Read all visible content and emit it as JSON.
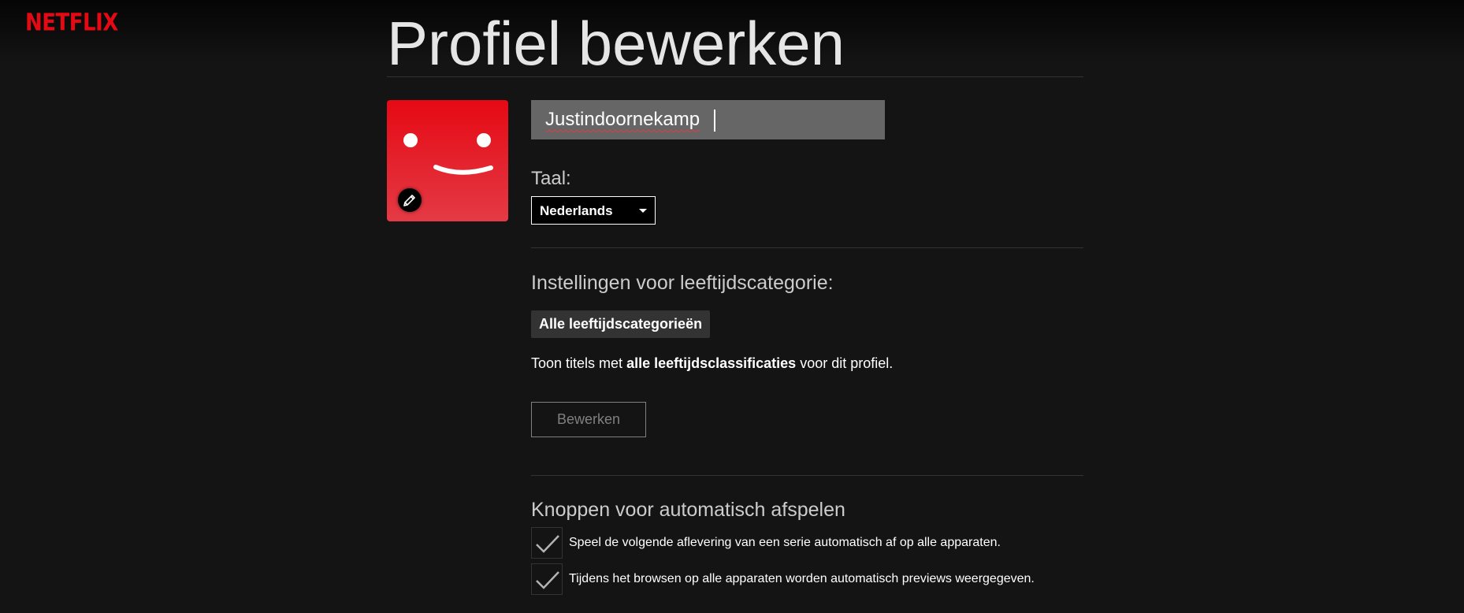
{
  "header": {
    "logo_text": "NETFLIX"
  },
  "page": {
    "title": "Profiel bewerken"
  },
  "profile": {
    "name_value": "Justindoornekamp",
    "avatar_icon": "smiley-face-icon",
    "edit_avatar_icon": "pencil-icon"
  },
  "language": {
    "label": "Taal:",
    "selected": "Nederlands"
  },
  "maturity": {
    "heading": "Instellingen voor leeftijdscategorie:",
    "badge": "Alle leeftijdscategorieën",
    "desc_prefix": "Toon titels met ",
    "desc_bold": "alle leeftijdsclassificaties",
    "desc_suffix": " voor dit profiel.",
    "edit_label": "Bewerken"
  },
  "autoplay": {
    "heading": "Knoppen voor automatisch afspelen",
    "options": [
      {
        "label": "Speel de volgende aflevering van een serie automatisch af op alle apparaten.",
        "checked": true
      },
      {
        "label": "Tijdens het browsen op alle apparaten worden automatisch previews weergegeven.",
        "checked": true
      }
    ]
  },
  "colors": {
    "brand_red": "#e50914",
    "background": "#141414",
    "input_bg": "#666666"
  }
}
